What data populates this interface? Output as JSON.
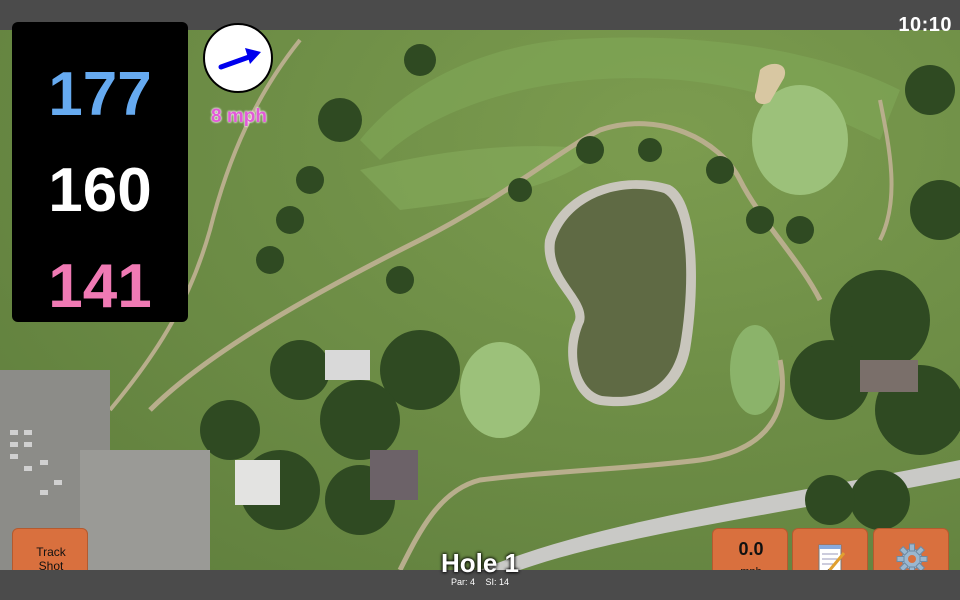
{
  "status": {
    "time": "10:10"
  },
  "distances": {
    "back": "177",
    "center": "160",
    "front": "141"
  },
  "wind": {
    "speed_label": "8 mph",
    "icon": "wind-arrow-icon"
  },
  "buttons": {
    "track_shot": "Track\nShot",
    "speed_value": "0.0",
    "speed_unit": "mph",
    "notes_icon": "notepad-icon",
    "settings_icon": "gear-icon"
  },
  "hole": {
    "title": "Hole 1",
    "par": "Par: 4",
    "si": "SI: 14"
  },
  "colors": {
    "back": "#66aaf0",
    "center": "#ffffff",
    "front": "#f07ab4",
    "wind_text": "#e25ad8",
    "button": "#d9703e"
  }
}
